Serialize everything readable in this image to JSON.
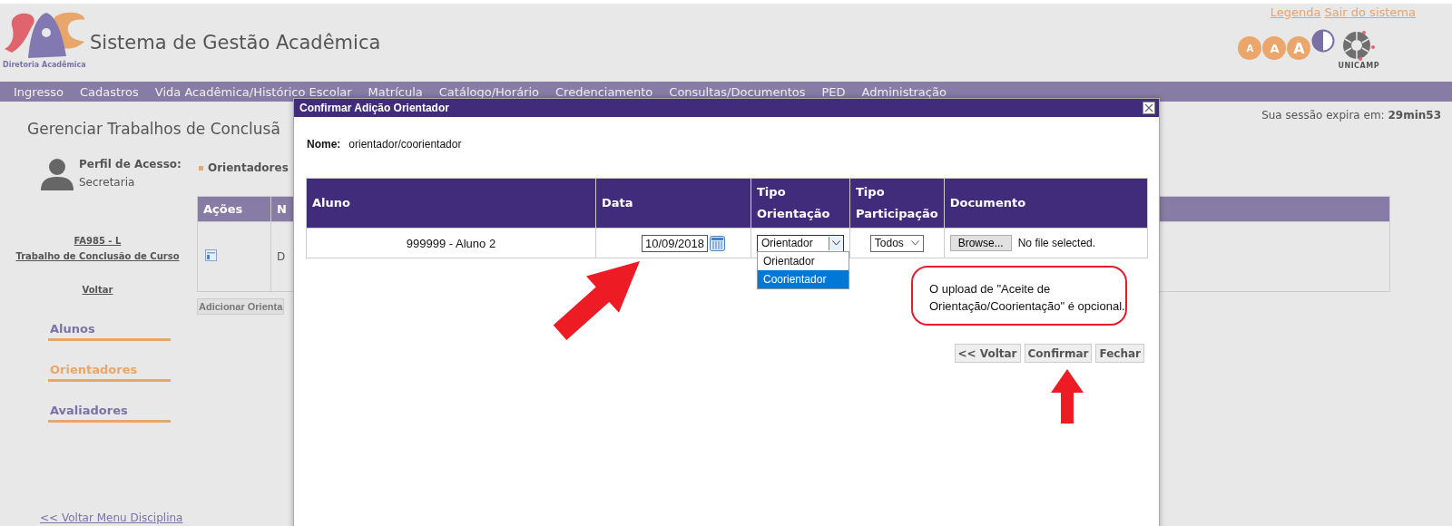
{
  "header": {
    "logo_caption": "Diretoria Acadêmica",
    "title": "Sistema de Gestão Acadêmica",
    "links": [
      "Legenda",
      "Sair do sistema"
    ],
    "font_buttons": [
      "A",
      "A",
      "A"
    ],
    "seal_caption": "UNICAMP"
  },
  "menu": [
    "Ingresso",
    "Cadastros",
    "Vida Acadêmica/Histórico Escolar",
    "Matrícula",
    "Catálogo/Horário",
    "Credenciamento",
    "Consultas/Documentos",
    "PED",
    "Administração"
  ],
  "session": "Sua sessão expira em: **29min53**",
  "page_title": "Gerenciar Trabalhos de Conclusã",
  "profile": {
    "label": "Perfil de Acesso:",
    "value": "Secretaria"
  },
  "course": {
    "code": "FA985 - L",
    "name": "Trabalho de Conclusão de Curso",
    "back": "Voltar"
  },
  "nav": [
    {
      "label": "Alunos",
      "selected": false
    },
    {
      "label": "Orientadores",
      "selected": true
    },
    {
      "label": "Avaliadores",
      "selected": false
    }
  ],
  "back_link": "<< Voltar Menu Disciplina",
  "section_label": "Orientadores",
  "background_table": {
    "columns": [
      "Ações",
      "N"
    ],
    "rows": [
      {
        "column_2": "D"
      }
    ]
  },
  "add_button": "Adicionar Orienta",
  "dialog": {
    "title": "Confirmar Adição Orientador",
    "name_label": "Nome:",
    "name_value": "orientador/coorientador",
    "columns": [
      "Aluno",
      "Data",
      "Tipo Orientação",
      "Tipo Participação",
      "Documento"
    ],
    "row": {
      "aluno": "999999 - Aluno 2",
      "data": "10/09/2018",
      "tipo_orientacao": "Orientador",
      "tipo_participacao": "Todos",
      "browse": "Browse...",
      "file_status": "No file selected."
    },
    "dropdown": {
      "expanded": true,
      "options": [
        {
          "label": "Orientador",
          "selected": false
        },
        {
          "label": "Coorientador",
          "selected": true
        }
      ]
    },
    "callout": "O upload de \"Aceite de Orientação/Coorientação\" é opcional.",
    "buttons": [
      "<< Voltar",
      "Confirmar",
      "Fechar"
    ]
  }
}
